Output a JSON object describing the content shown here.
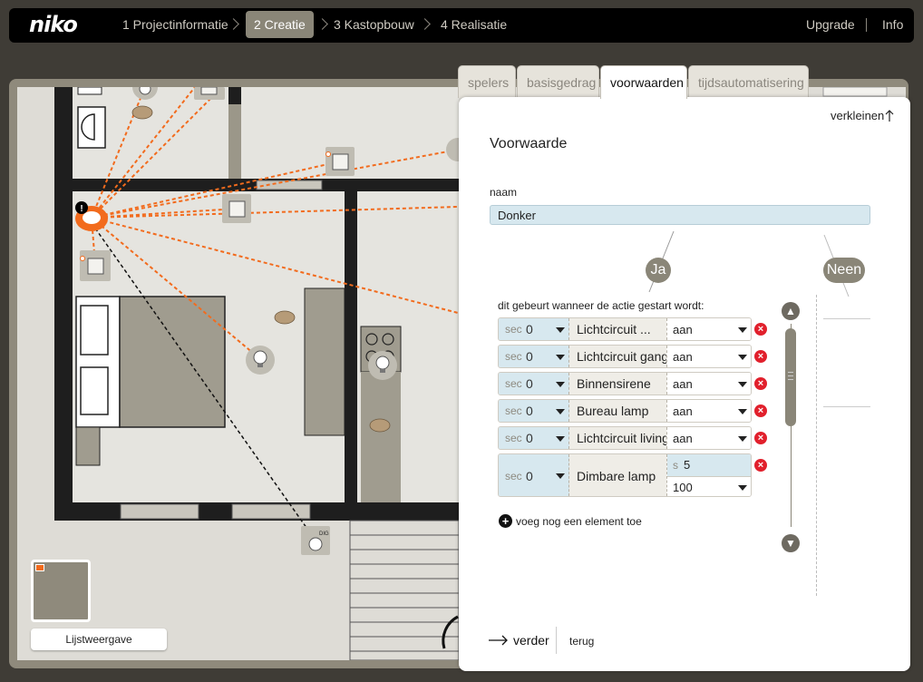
{
  "app": {
    "logo": "niko"
  },
  "steps": [
    {
      "label": "1 Projectinformatie",
      "active": false
    },
    {
      "label": "2 Creatie",
      "active": true
    },
    {
      "label": "3 Kastopbouw",
      "active": false
    },
    {
      "label": "4 Realisatie",
      "active": false
    }
  ],
  "top_links": {
    "upgrade": "Upgrade",
    "info": "Info"
  },
  "plan": {
    "list_view_button": "Lijstweergave",
    "dimmer_tag": "DIG",
    "alert_mark": "!"
  },
  "tabs": [
    {
      "label": "spelers",
      "active": false
    },
    {
      "label": "basisgedrag",
      "active": false
    },
    {
      "label": "voorwaarden",
      "active": true
    },
    {
      "label": "tijdsautomatisering",
      "active": false
    }
  ],
  "panel": {
    "collapse_label": "verkleinen",
    "title": "Voorwaarde",
    "name_label": "naam",
    "name_value": "Donker",
    "yes_label": "Ja",
    "no_label": "Neen",
    "action_intro": "dit gebeurt wanneer de actie gestart wordt:",
    "rows": [
      {
        "sec_label": "sec",
        "sec": "0",
        "name": "Lichtcircuit ...",
        "value": "aan"
      },
      {
        "sec_label": "sec",
        "sec": "0",
        "name": "Lichtcircuit gang",
        "value": "aan"
      },
      {
        "sec_label": "sec",
        "sec": "0",
        "name": "Binnensirene",
        "value": "aan"
      },
      {
        "sec_label": "sec",
        "sec": "0",
        "name": "Bureau lamp",
        "value": "aan"
      },
      {
        "sec_label": "sec",
        "sec": "0",
        "name": "Lichtcircuit living",
        "value": "aan"
      }
    ],
    "dimmer_row": {
      "sec_label": "sec",
      "sec": "0",
      "name": "Dimbare lamp",
      "duration_unit": "s",
      "duration": "5",
      "level": "100"
    },
    "add_element_label": "voeg nog een element toe",
    "next_label": "verder",
    "back_label": "terug"
  },
  "colors": {
    "accent_orange": "#f26b1d",
    "delete_red": "#e1202c",
    "input_blue": "#d7e8ef",
    "topbar": "#000000"
  }
}
